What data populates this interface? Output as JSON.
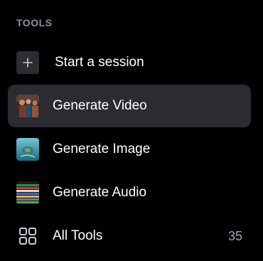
{
  "section": {
    "title": "TOOLS"
  },
  "items": [
    {
      "label": "Start a session",
      "icon": "plus-icon"
    },
    {
      "label": "Generate Video",
      "icon": "video-thumbnail",
      "active": true
    },
    {
      "label": "Generate Image",
      "icon": "image-thumbnail"
    },
    {
      "label": "Generate Audio",
      "icon": "audio-thumbnail"
    },
    {
      "label": "All Tools",
      "icon": "grid-icon",
      "count": "35"
    }
  ],
  "colors": {
    "background": "#000000",
    "active_row": "#2a2c31",
    "section_label": "#8b93a6",
    "count": "#9aa2b4"
  }
}
